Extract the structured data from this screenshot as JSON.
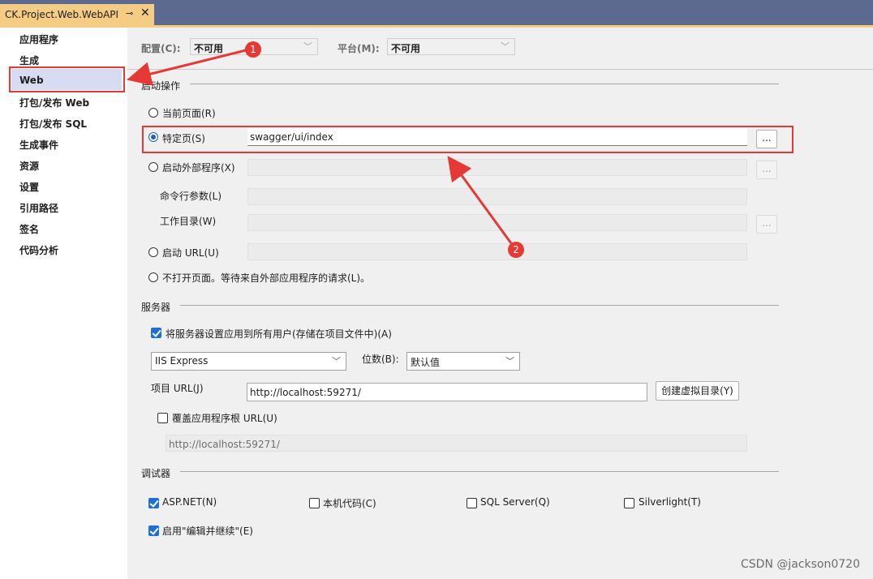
{
  "tab": {
    "title": "CK.Project.Web.WebAPI",
    "pin": "⊸",
    "close": "✕"
  },
  "sidebar": {
    "items": [
      {
        "label": "应用程序"
      },
      {
        "label": "生成"
      },
      {
        "label": "Web",
        "selected": true
      },
      {
        "label": "打包/发布 Web"
      },
      {
        "label": "打包/发布 SQL"
      },
      {
        "label": "生成事件"
      },
      {
        "label": "资源"
      },
      {
        "label": "设置"
      },
      {
        "label": "引用路径"
      },
      {
        "label": "签名"
      },
      {
        "label": "代码分析"
      }
    ]
  },
  "header": {
    "config_label": "配置(C):",
    "config_value": "不可用",
    "platform_label": "平台(M):",
    "platform_value": "不可用"
  },
  "start_action": {
    "title": "启动操作",
    "current_page": "当前页面(R)",
    "specific_page": "特定页(S)",
    "specific_page_value": "swagger/ui/index",
    "external_program": "启动外部程序(X)",
    "cmd_args": "命令行参数(L)",
    "working_dir": "工作目录(W)",
    "start_url": "启动 URL(U)",
    "dont_open": "不打开页面。等待来自外部应用程序的请求(L)。",
    "browse_label": "..."
  },
  "servers": {
    "title": "服务器",
    "apply_all_users": "将服务器设置应用到所有用户(存储在项目文件中)(A)",
    "server_value": "IIS Express",
    "bitness_label": "位数(B):",
    "bitness_value": "默认值",
    "project_url_label": "项目 URL(J)",
    "project_url_value": "http://localhost:59271/",
    "create_vdir": "创建虚拟目录(Y)",
    "override_root": "覆盖应用程序根 URL(U)",
    "override_root_value": "http://localhost:59271/"
  },
  "debuggers": {
    "title": "调试器",
    "aspnet": "ASP.NET(N)",
    "native": "本机代码(C)",
    "sql": "SQL Server(Q)",
    "silverlight": "Silverlight(T)",
    "edit_continue": "启用\"编辑并继续\"(E)"
  },
  "annotations": {
    "badge1": "1",
    "badge2": "2",
    "arrow_color": "#e53935"
  },
  "watermark": "CSDN @jackson0720"
}
